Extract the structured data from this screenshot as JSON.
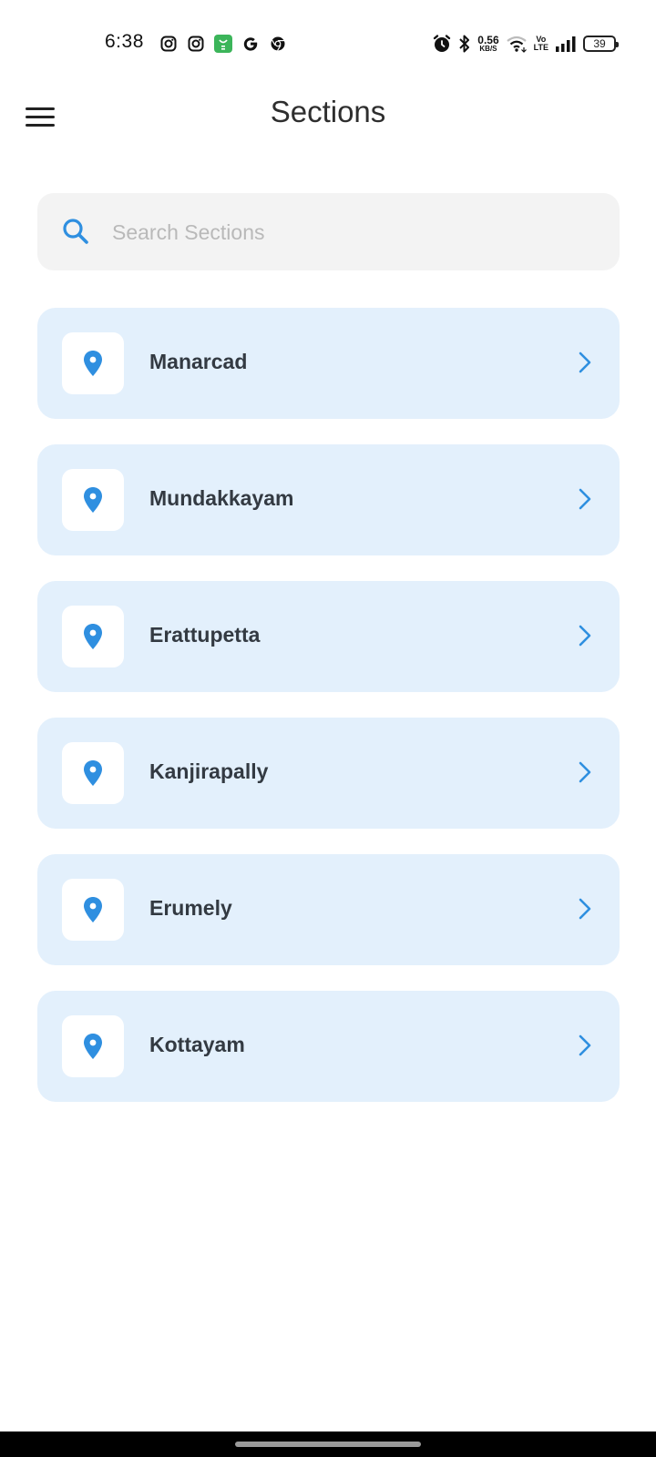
{
  "status_bar": {
    "time": "6:38",
    "net_speed_value": "0.56",
    "net_speed_unit": "KB/S",
    "volte_top": "Vo",
    "volte_bottom": "LTE",
    "battery": "39",
    "notification_icons": [
      "instagram-icon",
      "instagram-icon",
      "store-icon",
      "google-icon",
      "chrome-icon"
    ],
    "system_icons": [
      "alarm-icon",
      "bluetooth-icon",
      "wifi-icon",
      "signal-icon",
      "battery-icon"
    ]
  },
  "header": {
    "title": "Sections",
    "menu_icon": "hamburger-menu-icon"
  },
  "search": {
    "placeholder": "Search Sections",
    "value": ""
  },
  "sections": [
    {
      "label": "Manarcad"
    },
    {
      "label": "Mundakkayam"
    },
    {
      "label": "Erattupetta"
    },
    {
      "label": "Kanjirapally"
    },
    {
      "label": "Erumely"
    },
    {
      "label": "Kottayam"
    }
  ],
  "colors": {
    "accent": "#2f8fe0",
    "card_bg": "#e3f0fc",
    "search_bg": "#f3f3f3"
  }
}
